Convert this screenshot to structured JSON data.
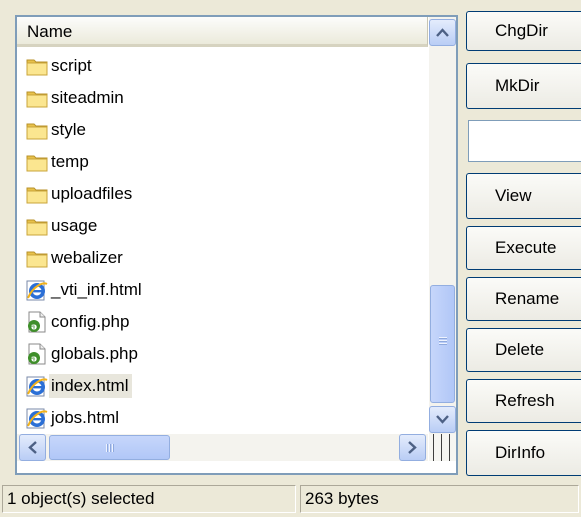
{
  "file_list": {
    "column_header": "Name",
    "items": [
      {
        "name": "script",
        "icon": "folder-icon",
        "selected": false
      },
      {
        "name": "siteadmin",
        "icon": "folder-icon",
        "selected": false
      },
      {
        "name": "style",
        "icon": "folder-icon",
        "selected": false
      },
      {
        "name": "temp",
        "icon": "folder-icon",
        "selected": false
      },
      {
        "name": "uploadfiles",
        "icon": "folder-icon",
        "selected": false
      },
      {
        "name": "usage",
        "icon": "folder-icon",
        "selected": false
      },
      {
        "name": "webalizer",
        "icon": "folder-icon",
        "selected": false
      },
      {
        "name": "_vti_inf.html",
        "icon": "ie-html-icon",
        "selected": false
      },
      {
        "name": "config.php",
        "icon": "php-file-icon",
        "selected": false
      },
      {
        "name": "globals.php",
        "icon": "php-file-icon",
        "selected": false
      },
      {
        "name": "index.html",
        "icon": "ie-html-icon",
        "selected": true
      },
      {
        "name": "jobs.html",
        "icon": "ie-html-icon",
        "selected": false
      }
    ]
  },
  "buttons": {
    "chgdir": "ChgDir",
    "mkdir": "MkDir",
    "view": "View",
    "execute": "Execute",
    "rename": "Rename",
    "delete": "Delete",
    "refresh": "Refresh",
    "dirinfo": "DirInfo"
  },
  "dir_input": {
    "value": ""
  },
  "status_bar": {
    "selection": "1 object(s) selected",
    "size": "263 bytes"
  },
  "colors": {
    "window_bg": "#ece9d8",
    "selection_bg": "#e8e6dc",
    "scrollbar_blue": "#b9cdf5",
    "folder_yellow": "#f5d86a"
  }
}
